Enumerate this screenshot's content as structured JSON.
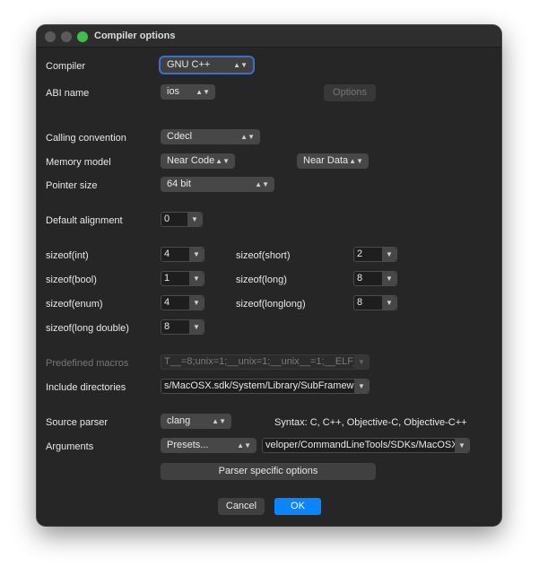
{
  "window": {
    "title": "Compiler options"
  },
  "compiler": {
    "label": "Compiler",
    "value": "GNU C++"
  },
  "abi": {
    "label": "ABI name",
    "value": "ios",
    "options_button": "Options"
  },
  "calling_convention": {
    "label": "Calling convention",
    "value": "Cdecl"
  },
  "memory_model": {
    "label": "Memory model",
    "code_value": "Near Code",
    "data_value": "Near Data"
  },
  "pointer_size": {
    "label": "Pointer size",
    "value": "64 bit"
  },
  "default_alignment": {
    "label": "Default alignment",
    "value": "0"
  },
  "sizeof": {
    "int": {
      "label": "sizeof(int)",
      "value": "4"
    },
    "short": {
      "label": "sizeof(short)",
      "value": "2"
    },
    "bool": {
      "label": "sizeof(bool)",
      "value": "1"
    },
    "long": {
      "label": "sizeof(long)",
      "value": "8"
    },
    "enum": {
      "label": "sizeof(enum)",
      "value": "4"
    },
    "longlong": {
      "label": "sizeof(longlong)",
      "value": "8"
    },
    "long_double": {
      "label": "sizeof(long double)",
      "value": "8"
    }
  },
  "predefined_macros": {
    "label": "Predefined macros",
    "value": "T__=8;unix=1;__unix=1;__unix__=1;__ELF__=1;"
  },
  "include_directories": {
    "label": "Include directories",
    "value": "s/MacOSX.sdk/System/Library/SubFrameworks"
  },
  "source_parser": {
    "label": "Source parser",
    "value": "clang",
    "syntax": "Syntax:  C, C++, Objective-C, Objective-C++"
  },
  "arguments": {
    "label": "Arguments",
    "presets": "Presets...",
    "value": "veloper/CommandLineTools/SDKs/MacOSX.sdk"
  },
  "parser_options_button": "Parser specific options",
  "footer": {
    "cancel": "Cancel",
    "ok": "OK"
  },
  "colors": {
    "accent": "#0a84ff",
    "window_bg": "#262626",
    "control_bg": "#474747"
  }
}
